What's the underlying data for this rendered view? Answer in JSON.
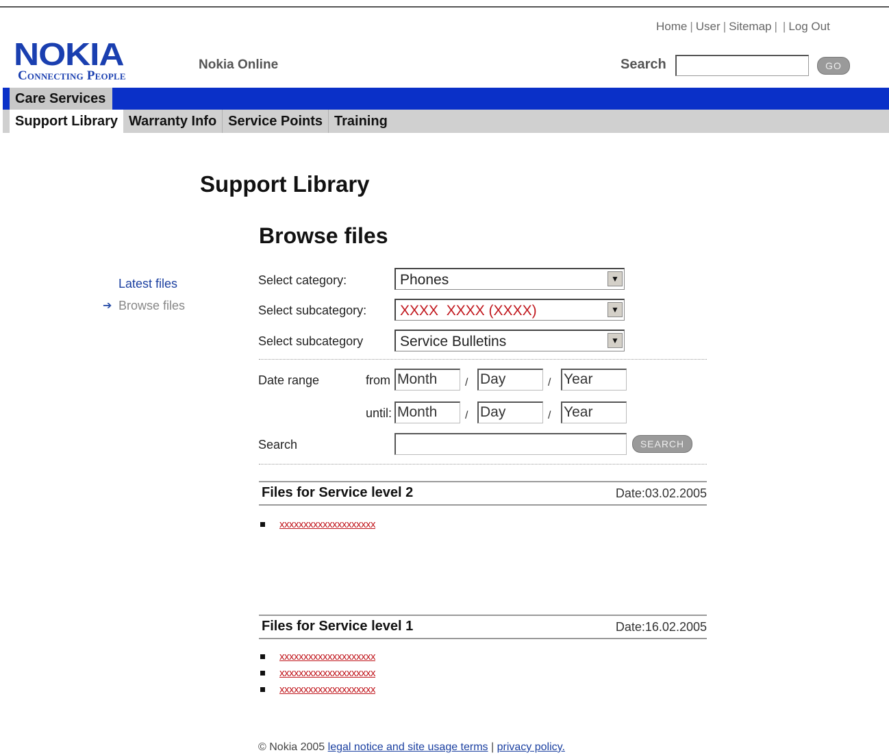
{
  "header": {
    "logo_text": "NOKIA",
    "logo_tagline": "Connecting People",
    "site_name": "Nokia Online",
    "utility_links": [
      "Home",
      "User",
      "Sitemap",
      "",
      "Log Out"
    ],
    "search_label": "Search",
    "go_label": "GO"
  },
  "nav": {
    "section": "Care Services",
    "tabs": [
      "Support Library",
      "Warranty Info",
      "Service Points",
      "Training"
    ],
    "active_tab": "Support Library"
  },
  "page": {
    "title": "Support Library",
    "section_title": "Browse files"
  },
  "sidebar": {
    "links": [
      {
        "label": "Latest files"
      },
      {
        "label": "Browse files",
        "current": true
      }
    ]
  },
  "form": {
    "category_label": "Select category:",
    "category_value": "Phones",
    "subcategory1_label": "Select subcategory:",
    "subcategory1_value": "XXXX  XXXX (XXXX)",
    "subcategory2_label": "Select subcategory",
    "subcategory2_value": "Service Bulletins",
    "date_range_label": "Date range",
    "from_label": "from",
    "until_label": "until:",
    "month_placeholder": "Month",
    "day_placeholder": "Day",
    "year_placeholder": "Year",
    "separator": "/",
    "search_label": "Search",
    "search_button": "SEARCH"
  },
  "results": [
    {
      "title": "Files for Service level 2",
      "date": "Date:03.02.2005",
      "files": [
        "xxxxxxxxxxxxxxxxxxxx"
      ]
    },
    {
      "title": "Files for Service level 1",
      "date": "Date:16.02.2005",
      "files": [
        "xxxxxxxxxxxxxxxxxxxx",
        "xxxxxxxxxxxxxxxxxxxx",
        "xxxxxxxxxxxxxxxxxxxx"
      ]
    }
  ],
  "footer": {
    "copyright": "© Nokia 2005",
    "legal_link": "legal notice and site usage terms",
    "separator": "|",
    "privacy_link": "privacy policy."
  },
  "colors": {
    "nav_blue": "#0a30c8",
    "logo_blue": "#1a3fb0",
    "link_red": "#c0161c",
    "link_blue": "#1a3fa0"
  }
}
